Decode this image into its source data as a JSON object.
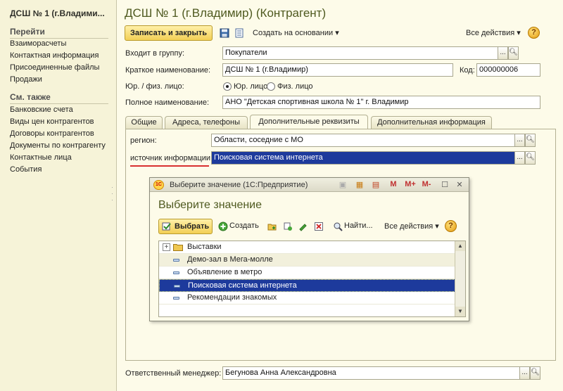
{
  "sidebar": {
    "title": "ДСШ № 1 (г.Владими...",
    "goto_heading": "Перейти",
    "goto_items": [
      "Взаиморасчеты",
      "Контактная информация",
      "Присоединенные файлы",
      "Продажи"
    ],
    "see_also_heading": "См. также",
    "see_also_items": [
      "Банковские счета",
      "Виды цен контрагентов",
      "Договоры контрагентов",
      "Документы по контрагенту",
      "Контактные лица",
      "События"
    ]
  },
  "form": {
    "title": "ДСШ № 1 (г.Владимир) (Контрагент)",
    "toolbar": {
      "save_close": "Записать и закрыть",
      "create_based_on": "Создать на основании",
      "all_actions": "Все действия",
      "help": "?"
    },
    "group": {
      "label": "Входит в группу:",
      "value": "Покупатели"
    },
    "short_name": {
      "label": "Краткое наименование:",
      "value": "ДСШ № 1 (г.Владимир)"
    },
    "code": {
      "label": "Код:",
      "value": "000000006"
    },
    "legal_type": {
      "label": "Юр. / физ. лицо:",
      "option1": "Юр. лицо",
      "option2": "Физ. лицо",
      "selected": "Юр. лицо"
    },
    "full_name": {
      "label": "Полное наименование:",
      "value": "АНО \"Детская спортивная школа  № 1\" г. Владимир"
    },
    "tabs": [
      "Общие",
      "Адреса, телефоны",
      "Дополнительные реквизиты",
      "Дополнительная информация"
    ],
    "active_tab": "Дополнительные реквизиты",
    "region": {
      "label": "регион:",
      "value": "Области, соседние с МО"
    },
    "source": {
      "label": "источник информации:",
      "value": "Поисковая система интернета"
    },
    "manager": {
      "label": "Ответственный менеджер:",
      "value": "Бегунова Анна Александровна"
    }
  },
  "dialog": {
    "title": "Выберите значение  (1С:Предприятие)",
    "logo": "1С",
    "tb_m": "M",
    "tb_mplus": "M+",
    "tb_mminus": "M-",
    "heading": "Выберите значение",
    "toolbar": {
      "select": "Выбрать",
      "create": "Создать",
      "find": "Найти...",
      "all_actions": "Все действия",
      "help": "?"
    },
    "items": [
      {
        "label": "Выставки",
        "kind": "group"
      },
      {
        "label": "Демо-зал в Мега-молле",
        "kind": "element"
      },
      {
        "label": "Объявление в метро",
        "kind": "element"
      },
      {
        "label": "Поисковая система интернета",
        "kind": "element",
        "selected": true
      },
      {
        "label": "Рекомендации знакомых",
        "kind": "element"
      }
    ]
  },
  "colors": {
    "accent_title": "#4f5a20",
    "selection": "#1d3a9c",
    "primary_button": "#f2cf55"
  }
}
